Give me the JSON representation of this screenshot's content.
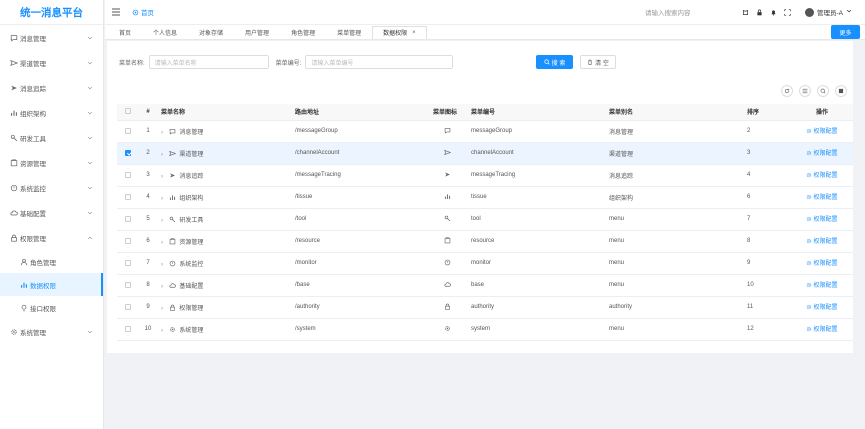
{
  "app": {
    "title": "统一消息平台"
  },
  "sidebar": {
    "items": [
      {
        "label": "消息管理",
        "icon": "message-icon"
      },
      {
        "label": "渠道管理",
        "icon": "send-icon"
      },
      {
        "label": "消息追踪",
        "icon": "trace-icon"
      },
      {
        "label": "组织架构",
        "icon": "org-icon"
      },
      {
        "label": "研发工具",
        "icon": "tool-icon"
      },
      {
        "label": "资源管理",
        "icon": "resource-icon"
      },
      {
        "label": "系统监控",
        "icon": "monitor-icon"
      },
      {
        "label": "基础配置",
        "icon": "cloud-icon"
      },
      {
        "label": "权限管理",
        "icon": "lock-icon",
        "expanded": true
      }
    ],
    "submenu": [
      {
        "label": "角色管理",
        "icon": "user-icon"
      },
      {
        "label": "数据权限",
        "icon": "chart-icon",
        "active": true
      },
      {
        "label": "接口权限",
        "icon": "bulb-icon"
      }
    ],
    "last": {
      "label": "系统管理",
      "icon": "gear-icon"
    }
  },
  "topbar": {
    "breadcrumb": "首页",
    "search_placeholder": "请输入搜索内容",
    "user": "管理员-A"
  },
  "tabs": [
    {
      "label": "首页"
    },
    {
      "label": "个人信息"
    },
    {
      "label": "对象存储"
    },
    {
      "label": "用户管理"
    },
    {
      "label": "角色管理"
    },
    {
      "label": "菜单管理"
    },
    {
      "label": "数据权限",
      "active": true
    }
  ],
  "more_label": "更多",
  "filter": {
    "name_label": "菜单名称:",
    "name_placeholder": "请输入菜单名称",
    "code_label": "菜单编号:",
    "code_placeholder": "请输入菜单编号",
    "search_label": "搜 索",
    "reset_label": "清 空"
  },
  "table": {
    "headers": [
      "#",
      "菜单名称",
      "路由地址",
      "菜单图标",
      "菜单编号",
      "菜单别名",
      "排序",
      "操作"
    ],
    "action_label": "权限配置",
    "rows": [
      {
        "no": "1",
        "name": "消息管理",
        "icon": "message-icon",
        "path": "/messageGroup",
        "code": "messageGroup",
        "alias": "消息管理",
        "sort": "2",
        "checked": false
      },
      {
        "no": "2",
        "name": "渠道管理",
        "icon": "send-icon",
        "path": "/channelAccount",
        "code": "channelAccount",
        "alias": "渠道管理",
        "sort": "3",
        "checked": true
      },
      {
        "no": "3",
        "name": "消息追踪",
        "icon": "trace-icon",
        "path": "/messageTracing",
        "code": "messageTracing",
        "alias": "消息追踪",
        "sort": "4",
        "checked": false
      },
      {
        "no": "4",
        "name": "组织架构",
        "icon": "org-icon",
        "path": "/tissue",
        "code": "tissue",
        "alias": "组织架构",
        "sort": "6",
        "checked": false
      },
      {
        "no": "5",
        "name": "研发工具",
        "icon": "tool-icon",
        "path": "/tool",
        "code": "tool",
        "alias": "menu",
        "sort": "7",
        "checked": false
      },
      {
        "no": "6",
        "name": "资源管理",
        "icon": "resource-icon",
        "path": "/resource",
        "code": "resource",
        "alias": "menu",
        "sort": "8",
        "checked": false
      },
      {
        "no": "7",
        "name": "系统监控",
        "icon": "monitor-icon",
        "path": "/monitor",
        "code": "monitor",
        "alias": "menu",
        "sort": "9",
        "checked": false
      },
      {
        "no": "8",
        "name": "基础配置",
        "icon": "cloud-icon",
        "path": "/base",
        "code": "base",
        "alias": "menu",
        "sort": "10",
        "checked": false
      },
      {
        "no": "9",
        "name": "权限管理",
        "icon": "lock-icon",
        "path": "/authority",
        "code": "authority",
        "alias": "authority",
        "sort": "11",
        "checked": false
      },
      {
        "no": "10",
        "name": "系统管理",
        "icon": "gear-icon",
        "path": "/system",
        "code": "system",
        "alias": "menu",
        "sort": "12",
        "checked": false
      }
    ]
  },
  "colors": {
    "accent": "#1890ff",
    "selected_row": "#ecf5ff"
  }
}
